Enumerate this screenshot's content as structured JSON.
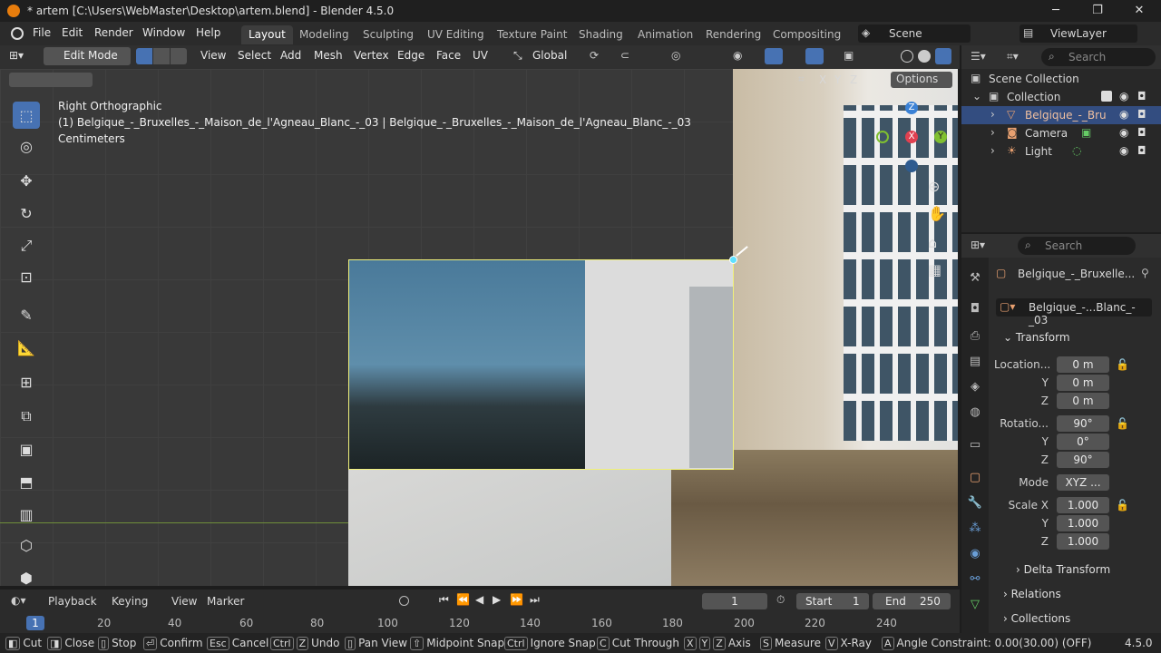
{
  "window": {
    "title": "* artem [C:\\Users\\WebMaster\\Desktop\\artem.blend] - Blender 4.5.0",
    "minimize": "─",
    "maximize": "❐",
    "close": "✕"
  },
  "menubar": {
    "items": [
      "File",
      "Edit",
      "Render",
      "Window",
      "Help"
    ],
    "workspaces": [
      "Layout",
      "Modeling",
      "Sculpting",
      "UV Editing",
      "Texture Paint",
      "Shading",
      "Animation",
      "Rendering",
      "Compositing"
    ],
    "active_workspace": "Layout",
    "scene": "Scene",
    "view_layer": "ViewLayer"
  },
  "viewport_header": {
    "mode": "Edit Mode",
    "menus": [
      "View",
      "Select",
      "Add",
      "Mesh",
      "Vertex",
      "Edge",
      "Face",
      "UV"
    ],
    "orientation": "Global",
    "axes": [
      "X",
      "Y",
      "Z"
    ],
    "options": "Options"
  },
  "viewport": {
    "view_name": "Right Orthographic",
    "object_info": "(1) Belgique_-_Bruxelles_-_Maison_de_l'Agneau_Blanc_-_03 | Belgique_-_Bruxelles_-_Maison_de_l'Agneau_Blanc_-_03",
    "units": "Centimeters",
    "gizmo": {
      "z": "Z",
      "x": "X",
      "y": "Y"
    }
  },
  "outliner": {
    "search_placeholder": "Search",
    "root": "Scene Collection",
    "collection": "Collection",
    "items": [
      "Belgique_-_Bru",
      "Camera",
      "Light"
    ]
  },
  "properties": {
    "search_placeholder": "Search",
    "object_name": "Belgique_-_Bruxelle...",
    "data_name": "Belgique_-...Blanc_-_03",
    "transform_title": "Transform",
    "location_label": "Location...",
    "location": [
      "0 m",
      "0 m",
      "0 m"
    ],
    "rotation_label": "Rotatio...",
    "rotation": [
      "90°",
      "0°",
      "90°"
    ],
    "mode_label": "Mode",
    "mode_value": "XYZ ...",
    "scale_label": "Scale X",
    "scale": [
      "1.000",
      "1.000",
      "1.000"
    ],
    "axis_y": "Y",
    "axis_z": "Z",
    "delta_transform": "Delta Transform",
    "relations": "Relations",
    "collections": "Collections"
  },
  "timeline": {
    "menus": [
      "Playback",
      "Keying",
      "View",
      "Marker"
    ],
    "current_frame": "1",
    "start_label": "Start",
    "start": "1",
    "end_label": "End",
    "end": "250",
    "ticks": [
      "1",
      "20",
      "40",
      "60",
      "80",
      "100",
      "120",
      "140",
      "160",
      "180",
      "200",
      "220",
      "240"
    ]
  },
  "statusbar": {
    "cut": "Cut",
    "close": "Close",
    "stop": "Stop",
    "confirm": "Confirm",
    "cancel_key": "Esc",
    "cancel": "Cancel",
    "undo_key": "Ctrl",
    "undo_key2": "Z",
    "undo": "Undo",
    "pan_view": "Pan View",
    "midpoint_snap": "Midpoint Snap",
    "ignore_snap_key": "Ctrl",
    "ignore_snap": "Ignore Snap",
    "cut_through_key": "C",
    "cut_through": "Cut Through",
    "axis": "Axis",
    "measure_key": "S",
    "measure": "Measure",
    "xray_key": "V",
    "xray": "X-Ray",
    "angle_key": "A",
    "angle": "Angle Constraint: 0.00(30.00) (OFF)",
    "version": "4.5.0"
  },
  "colors": {
    "accent": "#4772b3",
    "selected_row": "#334d80",
    "gizmo_x": "#e04050",
    "gizmo_y": "#80c030",
    "gizmo_z": "#3b82d6"
  }
}
